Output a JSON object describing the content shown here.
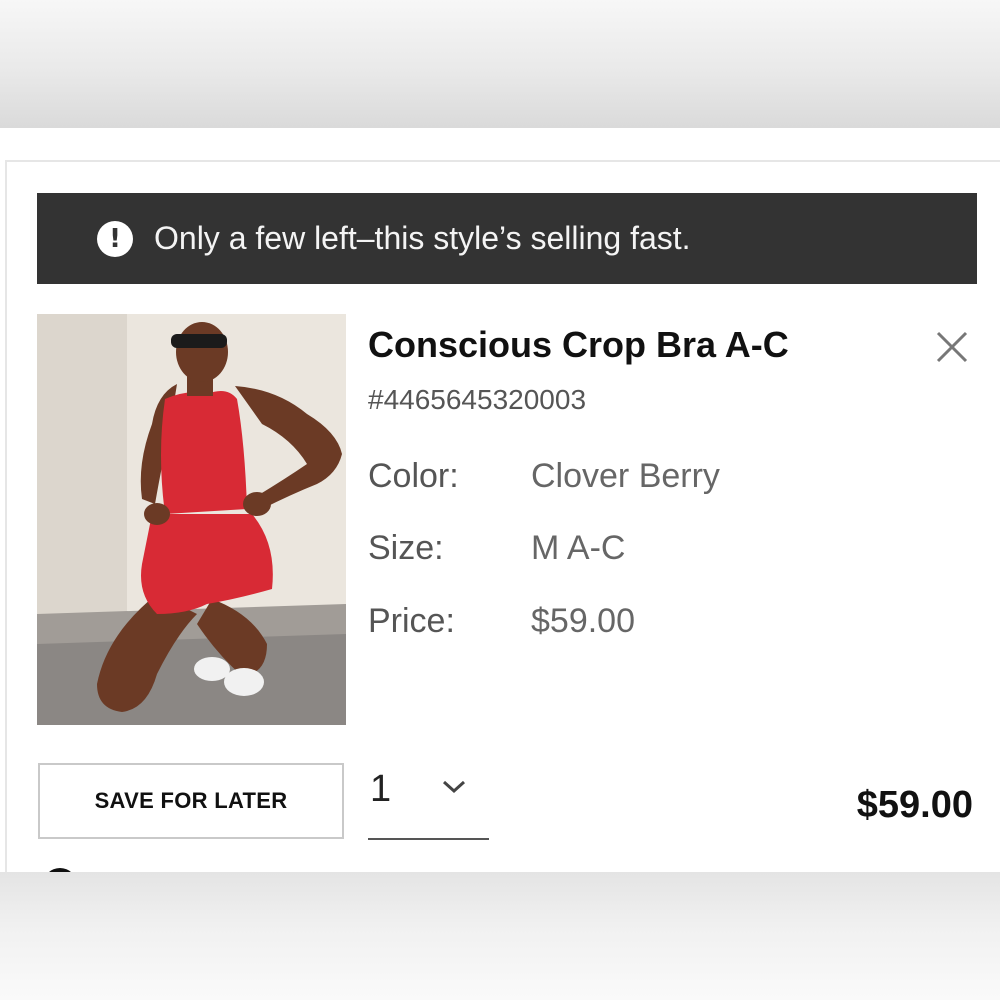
{
  "banner": {
    "icon": "alert-circle-icon",
    "message": "Only a few left–this style’s selling fast."
  },
  "product": {
    "title": "Conscious Crop Bra A-C",
    "sku": "#4465645320003",
    "color_label": "Color:",
    "color_value": "Clover Berry",
    "size_label": "Size:",
    "size_value": "M A-C",
    "price_label": "Price:",
    "price_value": "$59.00"
  },
  "actions": {
    "save_for_later": "SAVE FOR LATER",
    "quantity": "1",
    "total": "$59.00"
  },
  "colors": {
    "banner_bg": "#333333",
    "garment": "#d82a35"
  }
}
